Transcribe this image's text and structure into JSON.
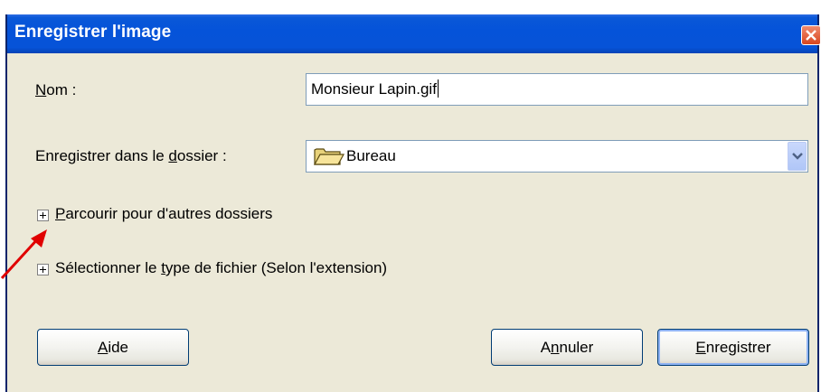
{
  "dialog": {
    "title": "Enregistrer l'image"
  },
  "form": {
    "name_label_first": "N",
    "name_label_rest": "om :",
    "name_value": "Monsieur Lapin.gif",
    "folder_label_pre": "Enregistrer dans le ",
    "folder_label_ul": "d",
    "folder_label_post": "ossier :",
    "folder_value": "Bureau"
  },
  "expanders": {
    "browse_ul": "P",
    "browse_rest": "arcourir pour d'autres dossiers",
    "filetype_pre": "Sélectionner le ",
    "filetype_ul": "t",
    "filetype_post": "ype de fichier (Selon l'extension)"
  },
  "buttons": {
    "help_ul": "A",
    "help_rest": "ide",
    "cancel_pre": "A",
    "cancel_ul": "n",
    "cancel_post": "nuler",
    "save_ul": "E",
    "save_rest": "nregistrer"
  },
  "colors": {
    "titlebar": "#0553d9",
    "dialog_bg": "#ece9d8",
    "annotation_arrow": "#e00000"
  },
  "icons": {
    "close": "close-icon",
    "folder": "folder-icon",
    "dropdown": "chevron-down-icon",
    "expand": "plus-box-icon",
    "annotation": "red-arrow-icon"
  }
}
